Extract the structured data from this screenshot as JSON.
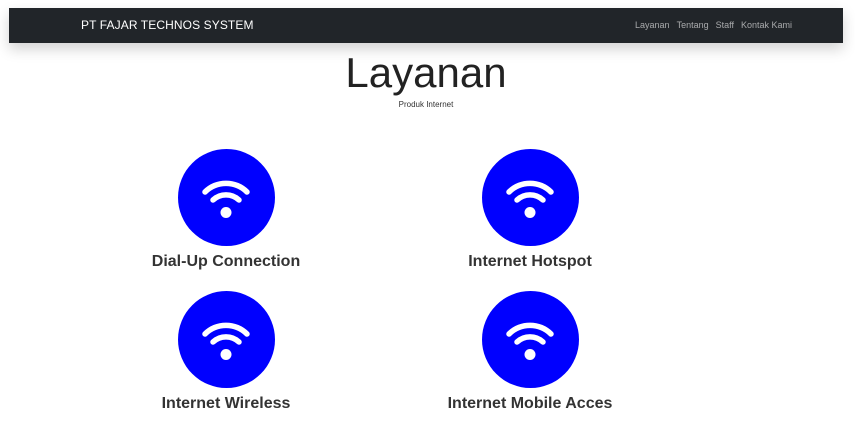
{
  "navbar": {
    "brand": "PT FAJAR TECHNOS SYSTEM",
    "links": [
      "Layanan",
      "Tentang",
      "Staff",
      "Kontak Kami"
    ]
  },
  "header": {
    "title": "Layanan",
    "subtitle": "Produk Internet"
  },
  "services": [
    {
      "name": "Dial-Up Connection",
      "icon": "wifi-icon"
    },
    {
      "name": "Internet Hotspot",
      "icon": "wifi-icon"
    },
    {
      "name": "Internet Wireless",
      "icon": "wifi-icon"
    },
    {
      "name": "Internet Mobile Acces",
      "icon": "wifi-icon"
    }
  ],
  "colors": {
    "navbar_bg": "#212529",
    "icon_circle": "#0000ff",
    "icon_glyph": "#ffffff"
  }
}
